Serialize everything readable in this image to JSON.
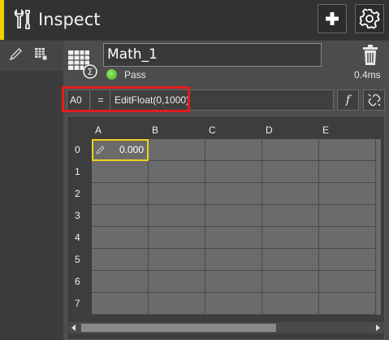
{
  "title": "Inspect",
  "tool": {
    "name": "Math_1",
    "status": "Pass",
    "time": "0.4ms",
    "status_color": "#5cc93a"
  },
  "formula": {
    "cell_ref": "A0",
    "equals": "=",
    "expression": "EditFloat(0,1000)",
    "fx_label": "f"
  },
  "grid": {
    "columns": [
      "A",
      "B",
      "C",
      "D",
      "E"
    ],
    "rows": [
      "0",
      "1",
      "2",
      "3",
      "4",
      "5",
      "6",
      "7"
    ],
    "a0_value": "0.000"
  },
  "icons": {
    "title": "wrench-screwdriver-icon",
    "add": "plus-icon",
    "settings": "gear-icon",
    "pencil_tab": "pencil-icon",
    "table_tab": "table-icon",
    "tool": "math-spreadsheet-icon",
    "delete": "trash-icon",
    "link": "unlink-icon"
  },
  "colors": {
    "accent": "#f0d000",
    "highlight": "#e41c1c",
    "selection": "#f0d020"
  }
}
